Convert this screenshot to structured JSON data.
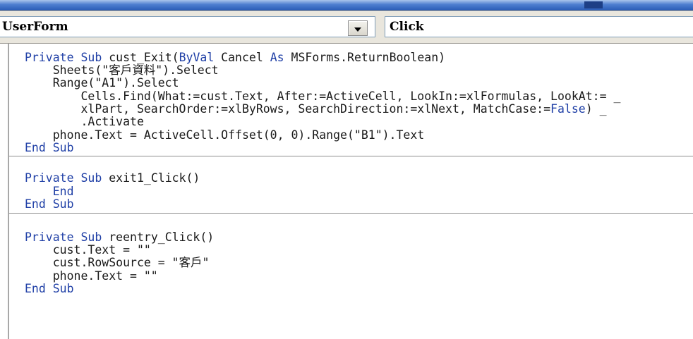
{
  "window": {
    "object_combo": "UserForm",
    "procedure_combo": "Click"
  },
  "code": {
    "proc1": [
      "Private Sub cust_Exit(ByVal Cancel As MSForms.ReturnBoolean)",
      "    Sheets(\"客戶資料\").Select",
      "    Range(\"A1\").Select",
      "        Cells.Find(What:=cust.Text, After:=ActiveCell, LookIn:=xlFormulas, LookAt:= _",
      "        xlPart, SearchOrder:=xlByRows, SearchDirection:=xlNext, MatchCase:=False) _",
      "        .Activate",
      "    phone.Text = ActiveCell.Offset(0, 0).Range(\"B1\").Text",
      "End Sub"
    ],
    "proc2": [
      "Private Sub exit1_Click()",
      "    End",
      "End Sub"
    ],
    "proc3": [
      "Private Sub reentry_Click()",
      "    cust.Text = \"\"",
      "    cust.RowSource = \"客戶\"",
      "    phone.Text = \"\"",
      "End Sub"
    ]
  },
  "colors": {
    "keyword": "#1f3fa6",
    "text": "#1a1a1a",
    "separator": "#8d8d8d"
  }
}
